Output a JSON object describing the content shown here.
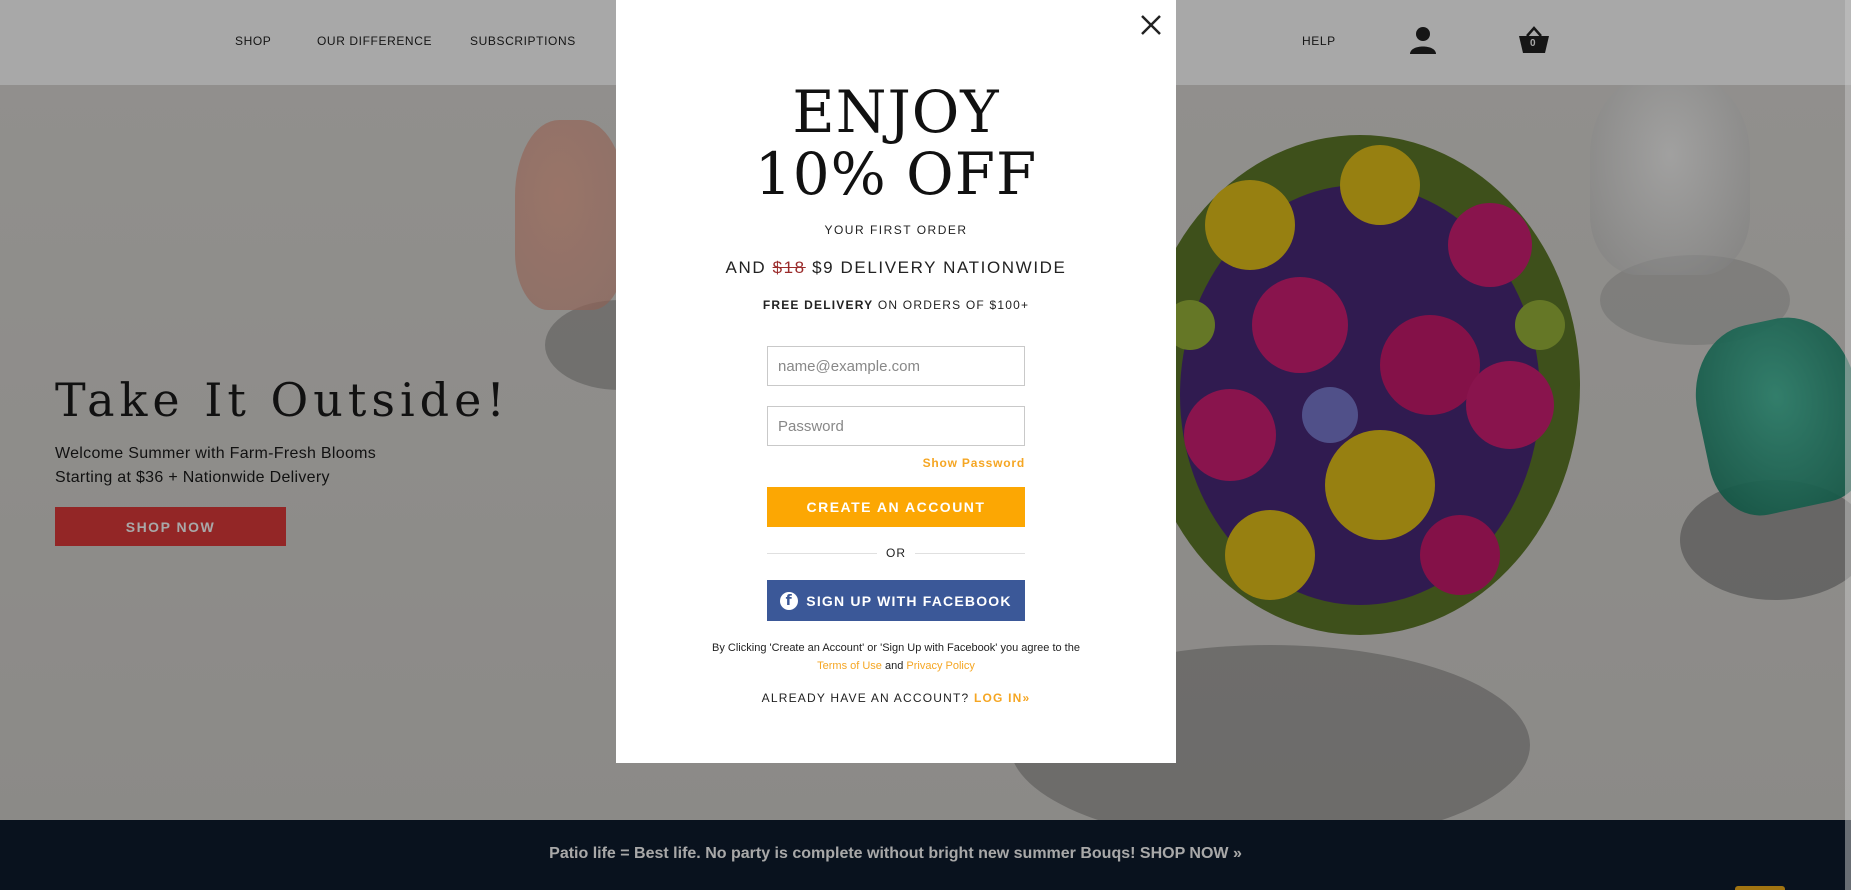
{
  "header": {
    "nav": [
      {
        "label": "SHOP"
      },
      {
        "label": "OUR DIFFERENCE"
      },
      {
        "label": "SUBSCRIPTIONS"
      },
      {
        "label": "HELP"
      }
    ],
    "cart_count": "0"
  },
  "hero": {
    "title": "Take It Outside!",
    "subtitle_1": "Welcome Summer with Farm-Fresh Blooms",
    "subtitle_2": "Starting at $36 + Nationwide Delivery",
    "cta_label": "SHOP NOW"
  },
  "promo_bar": {
    "text": "Patio life = Best life. No party is complete without bright new summer Bouqs!  SHOP NOW »"
  },
  "modal": {
    "title_line_1": "ENJOY",
    "title_line_2": "10% OFF",
    "first_order": "YOUR FIRST ORDER",
    "delivery_prefix": "AND",
    "delivery_old_price": "$18",
    "delivery_new": "$9 DELIVERY NATIONWIDE",
    "free_delivery_bold": "FREE DELIVERY",
    "free_delivery_rest": "ON ORDERS OF $100+",
    "email_placeholder": "name@example.com",
    "password_placeholder": "Password",
    "show_password": "Show Password",
    "create_account": "CREATE AN ACCOUNT",
    "or": "OR",
    "facebook_label": "SIGN UP WITH FACEBOOK",
    "facebook_icon": "f",
    "legal_text_1": "By Clicking 'Create an Account' or 'Sign Up with Facebook' you agree to the",
    "terms_link": "Terms of Use",
    "legal_and": "and",
    "privacy_link": "Privacy Policy",
    "already_text": "ALREADY HAVE AN ACCOUNT?",
    "login_link": "LOG IN»"
  },
  "colors": {
    "accent_orange": "#fca703",
    "facebook_blue": "#3b5898",
    "hero_cta_red": "#e03b3b",
    "promo_bar_navy": "#0f1c2e"
  }
}
